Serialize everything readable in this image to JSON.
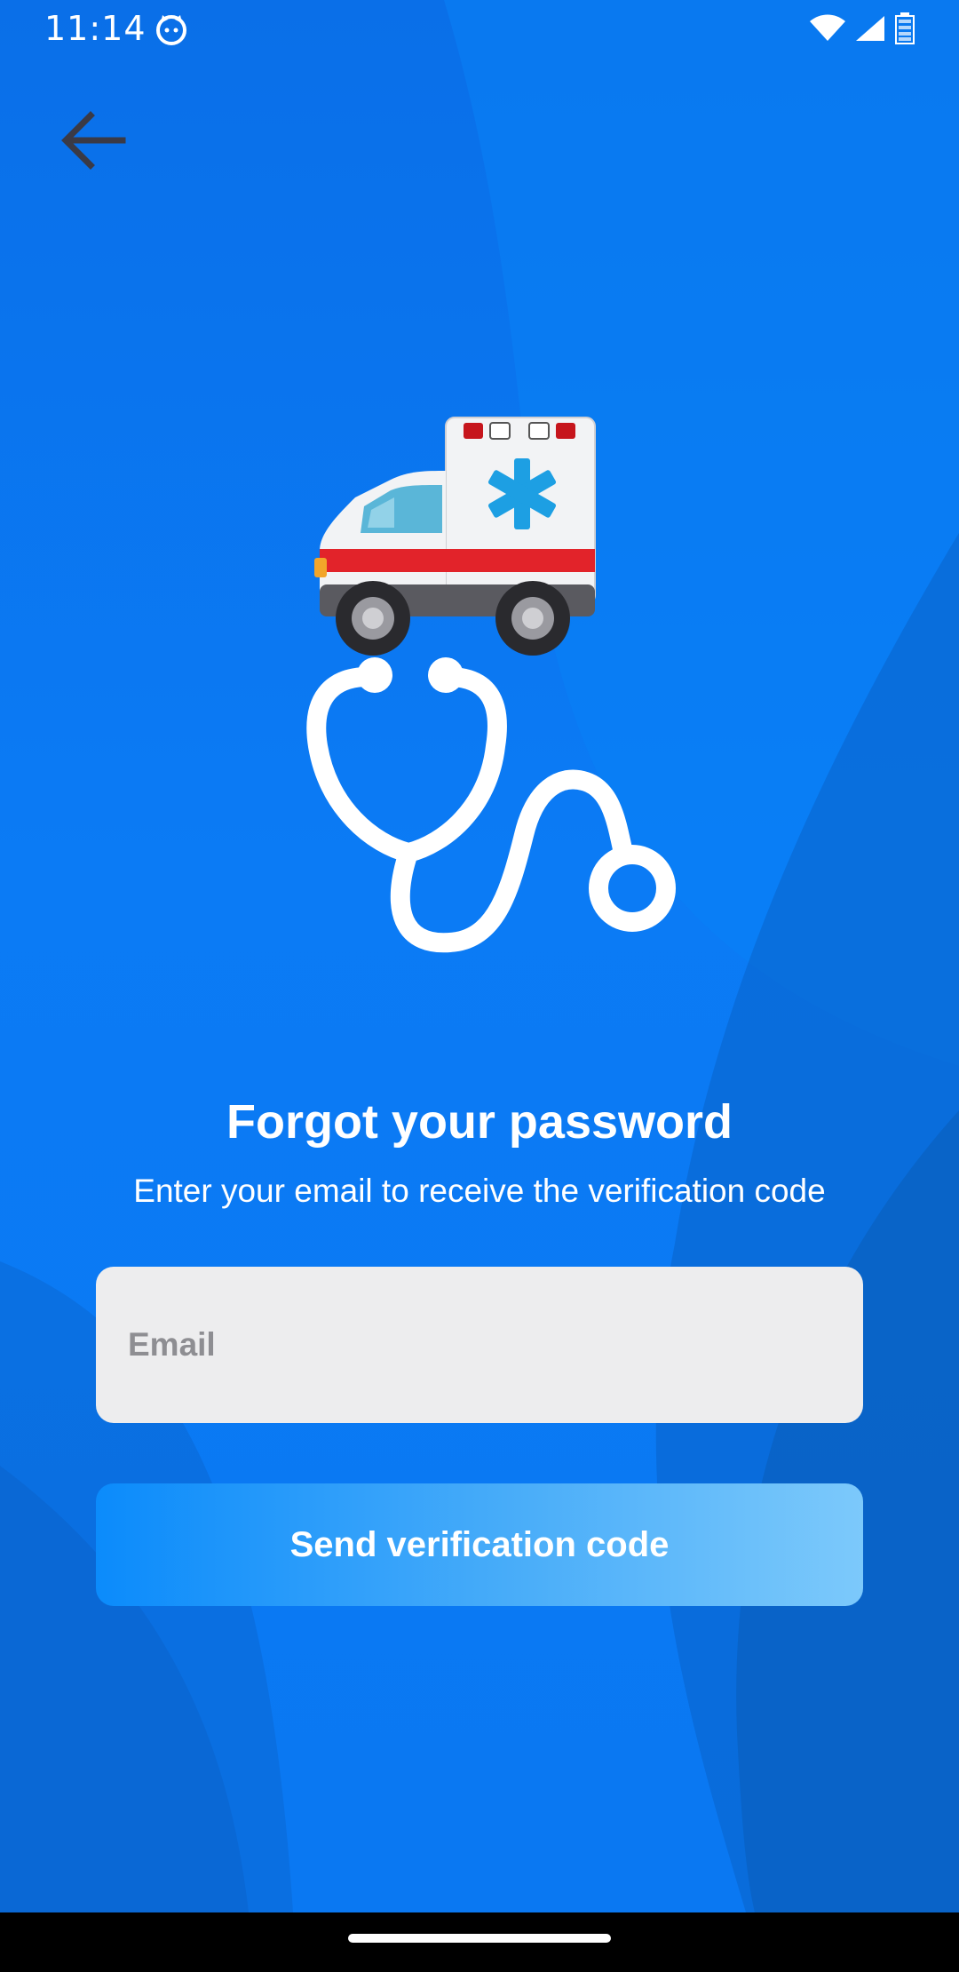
{
  "status_bar": {
    "time": "11:14",
    "app_icon": "cat-face-icon",
    "wifi_icon": "wifi-icon",
    "signal_icon": "signal-icon",
    "battery_icon": "battery-icon"
  },
  "header": {
    "back_icon": "arrow-left-icon"
  },
  "illustration": {
    "ambulance_icon": "ambulance-icon",
    "stethoscope_icon": "stethoscope-icon"
  },
  "content": {
    "title": "Forgot your password",
    "subtitle": "Enter your email to receive the verification code"
  },
  "form": {
    "email_placeholder": "Email",
    "email_value": "",
    "send_button_label": "Send verification code"
  },
  "colors": {
    "background": "#0b7bf5",
    "field_background": "#ededee",
    "button_gradient_start": "#0b8bfb",
    "button_gradient_end": "#7cc9fb",
    "text_light": "#ffffff"
  }
}
